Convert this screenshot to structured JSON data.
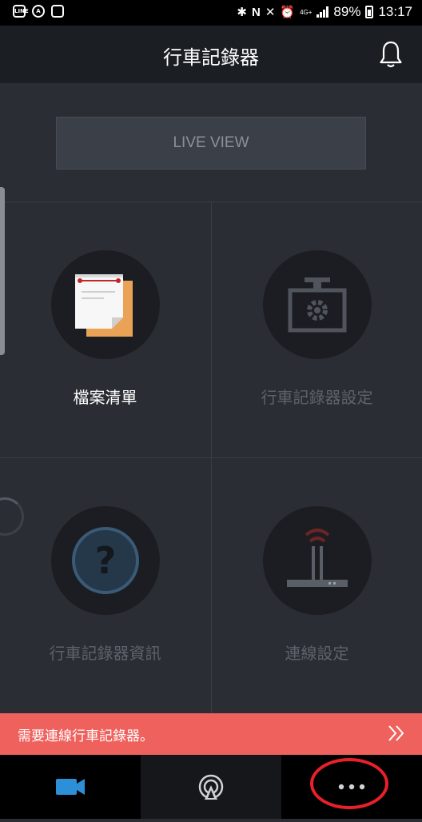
{
  "status_bar": {
    "left_icons": [
      "line-icon",
      "a-icon",
      "image-icon"
    ],
    "right_icons": [
      "bluetooth-icon",
      "nfc-icon",
      "mute-icon",
      "alarm-icon",
      "4g-icon",
      "signal-icon"
    ],
    "network_label": "4G+",
    "battery_percent": "89%",
    "time": "13:17"
  },
  "header": {
    "title": "行車記錄器",
    "notification_icon": "bell-icon"
  },
  "live_view": {
    "label": "LIVE VIEW"
  },
  "tiles": [
    {
      "label": "檔案清單",
      "icon": "file-list-icon",
      "state": "active"
    },
    {
      "label": "行車記錄器設定",
      "icon": "dashcam-settings-icon",
      "state": "disabled"
    },
    {
      "label": "行車記錄器資訊",
      "icon": "question-icon",
      "state": "disabled"
    },
    {
      "label": "連線設定",
      "icon": "router-icon",
      "state": "disabled"
    }
  ],
  "banner": {
    "text": "需要連線行車記錄器。",
    "icon": "double-chevron-right-icon",
    "color": "#ef615d"
  },
  "bottom_nav": [
    {
      "icon": "video-camera-icon",
      "selected": true,
      "color": "#2d8fd8"
    },
    {
      "icon": "wifi-broadcast-icon",
      "selected": false
    },
    {
      "icon": "more-dots-icon",
      "selected": false
    }
  ],
  "colors": {
    "background": "#2a2d33",
    "header": "#1b1e23",
    "accent_blue": "#2d8fd8",
    "annotation_red": "#e8202a"
  }
}
